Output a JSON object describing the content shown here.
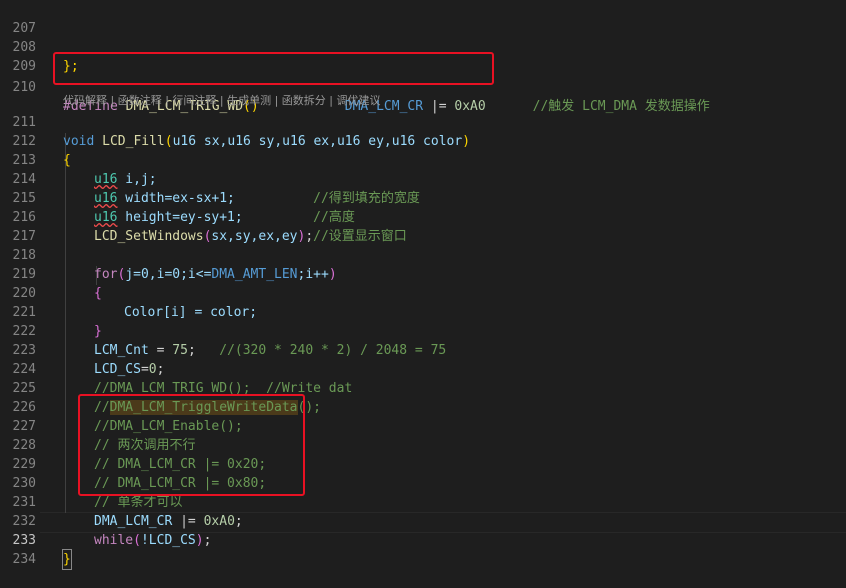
{
  "editor": {
    "active_line": "233",
    "lines": [
      {
        "num": "207",
        "text": ""
      },
      {
        "num": "208",
        "text": "};"
      },
      {
        "num": "209",
        "text": ""
      },
      {
        "num": "210",
        "pp": "#define ",
        "fn": "DMA_LCM_TRIG_WD",
        "paren": "()",
        "gap": "           ",
        "macro": "DMA_LCM_CR",
        "op": " |= ",
        "num2": "0xA0",
        "gap2": "      ",
        "cm": "//触发 LCM_DMA 发数据操作"
      },
      {
        "num": "",
        "hint": "代码解释 | 函数注释 | 行间注释 | 生成单测 | 函数拆分 | 调优建议"
      },
      {
        "num": "211",
        "kw": "void ",
        "fn": "LCD_Fill",
        "rest": "u16 sx,u16 sy,u16 ex,u16 ey,u16 color"
      },
      {
        "num": "212",
        "text": "{"
      },
      {
        "num": "213",
        "ty": "u16",
        "rest": " i,j;"
      },
      {
        "num": "214",
        "ty": "u16",
        "rest": " width=ex-sx+1;",
        "gap": "          ",
        "cm": "//得到填充的宽度"
      },
      {
        "num": "215",
        "ty": "u16",
        "rest": " height=ey-sy+1;",
        "gap": "         ",
        "cm": "//高度"
      },
      {
        "num": "216",
        "fn": "LCD_SetWindows",
        "rest": "sx,sy,ex,ey",
        "cm": "//设置显示窗口"
      },
      {
        "num": "217",
        "text": ""
      },
      {
        "num": "218",
        "kw": "for",
        "rest_a": "j=0,i=0;i<=",
        "macro": "DMA_AMT_LEN",
        "rest_b": ";i++"
      },
      {
        "num": "219",
        "text": "{"
      },
      {
        "num": "220",
        "var": "Color",
        "rest": "[i] = color;"
      },
      {
        "num": "221",
        "text": "}"
      },
      {
        "num": "222",
        "var": "LCM_Cnt",
        "rest": " = ",
        "num2": "75",
        "gap": ";   ",
        "cm": "//(320 * 240 * 2) / 2048 = 75"
      },
      {
        "num": "223",
        "var": "LCD_CS",
        "rest": "=",
        "num2": "0",
        "end": ";"
      },
      {
        "num": "224",
        "cm": "//DMA_LCM_TRIG_WD();  //Write dat"
      },
      {
        "num": "225",
        "cm": "//",
        "cmhl": "DMA_LCM_TriggleWriteData",
        "cm2": "();"
      },
      {
        "num": "226",
        "cm": "//DMA_LCM_Enable();"
      },
      {
        "num": "227",
        "cm": "// 两次调用不行"
      },
      {
        "num": "228",
        "cm": "// DMA_LCM_CR |= 0x20;"
      },
      {
        "num": "229",
        "cm": "// DMA_LCM_CR |= 0x80;"
      },
      {
        "num": "230",
        "cm": "// 单条才可以"
      },
      {
        "num": "231",
        "var": "DMA_LCM_CR",
        "rest": " |= ",
        "num2": "0xA0",
        "end": ";"
      },
      {
        "num": "232",
        "kw": "while",
        "rest": "!LCD_CS",
        "end": ";"
      },
      {
        "num": "233",
        "text": "}"
      },
      {
        "num": "234",
        "text": ""
      }
    ]
  },
  "colors": {
    "background": "#1e1e1e",
    "highlight_box": "#e81123",
    "comment": "#6a9955",
    "keyword": "#569cd6",
    "function": "#dcdcaa"
  }
}
